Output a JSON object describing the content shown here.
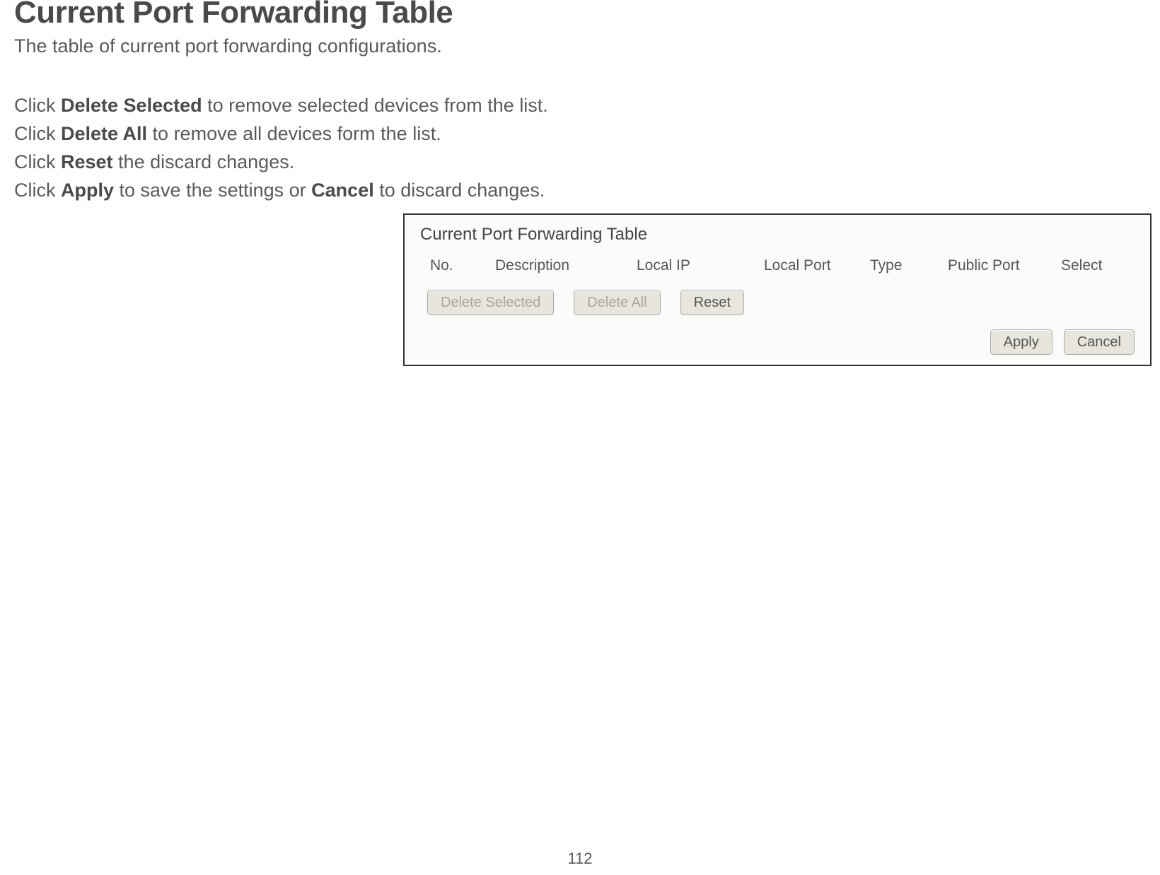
{
  "page": {
    "title": "Current Port Forwarding Table",
    "subtitle": "The table of current port forwarding configurations.",
    "page_number": "112"
  },
  "instructions": {
    "line1": {
      "pre": "Click ",
      "bold": "Delete Selected",
      "post": " to remove selected devices from the list."
    },
    "line2": {
      "pre": "Click ",
      "bold": "Delete All",
      "post": " to remove all devices form the list."
    },
    "line3": {
      "pre": "Click ",
      "bold": "Reset",
      "post": " the discard changes."
    },
    "line4": {
      "pre": "Click ",
      "bold1": "Apply",
      "mid": " to save the settings or ",
      "bold2": "Cancel",
      "post": " to discard changes."
    }
  },
  "panel": {
    "title": "Current Port Forwarding Table",
    "columns": {
      "no": "No.",
      "desc": "Description",
      "lip": "Local IP",
      "lport": "Local Port",
      "type": "Type",
      "pport": "Public Port",
      "select": "Select"
    },
    "buttons": {
      "delete_selected": "Delete Selected",
      "delete_all": "Delete All",
      "reset": "Reset",
      "apply": "Apply",
      "cancel": "Cancel"
    }
  }
}
